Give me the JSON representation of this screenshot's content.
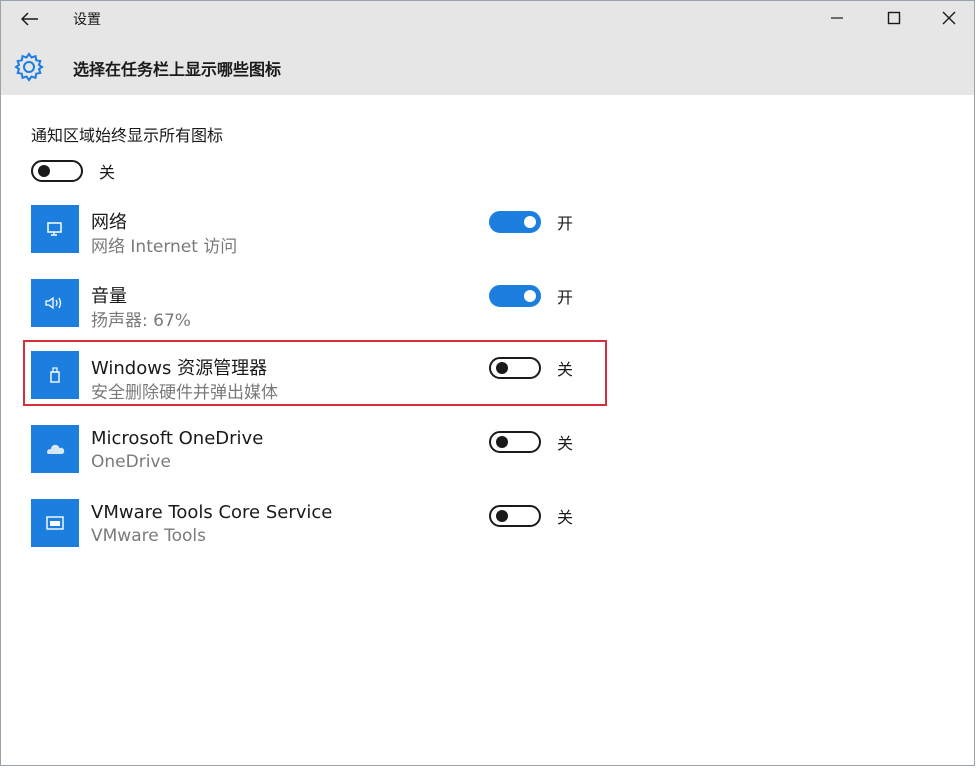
{
  "window": {
    "title": "设置",
    "page_title": "选择在任务栏上显示哪些图标"
  },
  "master": {
    "label": "通知区域始终显示所有图标",
    "state": "关"
  },
  "items": [
    {
      "title": "网络",
      "subtitle": "网络 Internet 访问",
      "state": "开",
      "icon": "network-monitor-icon"
    },
    {
      "title": "音量",
      "subtitle": "扬声器: 67%",
      "state": "开",
      "icon": "speaker-volume-icon"
    },
    {
      "title": "Windows 资源管理器",
      "subtitle": "安全删除硬件并弹出媒体",
      "state": "关",
      "icon": "usb-drive-icon"
    },
    {
      "title": "Microsoft OneDrive",
      "subtitle": "OneDrive",
      "state": "关",
      "icon": "cloud-icon"
    },
    {
      "title": "VMware Tools Core Service",
      "subtitle": "VMware Tools",
      "state": "关",
      "icon": "vmware-icon"
    }
  ],
  "colors": {
    "accent": "#1c7fe0",
    "header_bg": "#e6e6e6",
    "highlight": "#d42f3b"
  }
}
